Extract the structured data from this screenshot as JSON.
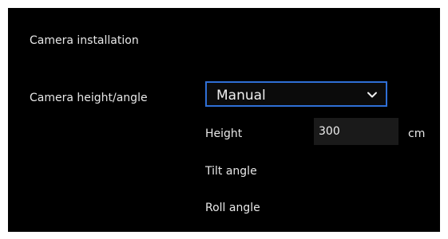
{
  "section": {
    "title": "Camera installation"
  },
  "camera_height_angle": {
    "label": "Camera height/angle",
    "select": {
      "value": "Manual",
      "icon": "chevron-down-icon"
    }
  },
  "fields": {
    "height": {
      "label": "Height",
      "value": "300",
      "unit": "cm"
    },
    "tilt": {
      "label": "Tilt angle"
    },
    "roll": {
      "label": "Roll angle"
    }
  },
  "colors": {
    "background": "#000000",
    "select_border": "#2f6fd6",
    "input_bg": "#1a1a1a"
  }
}
